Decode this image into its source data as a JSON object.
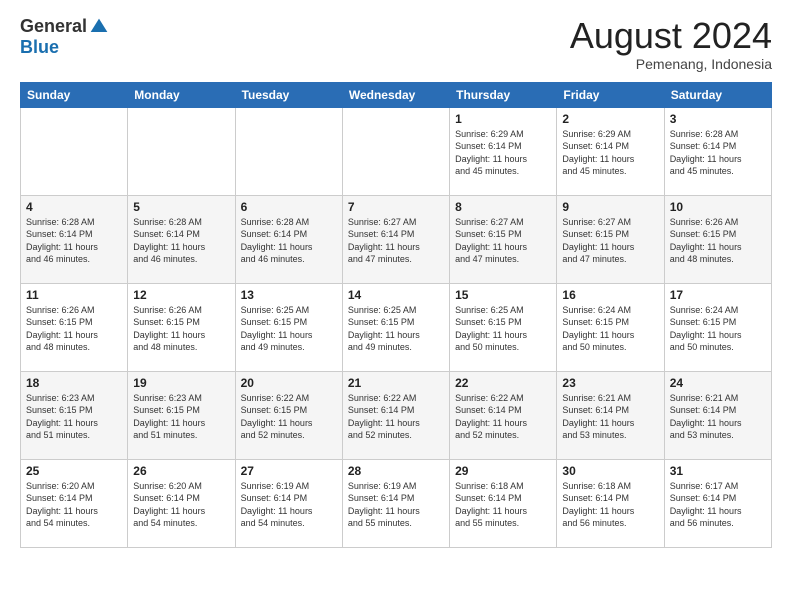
{
  "logo": {
    "general": "General",
    "blue": "Blue"
  },
  "title": {
    "month_year": "August 2024",
    "location": "Pemenang, Indonesia"
  },
  "headers": [
    "Sunday",
    "Monday",
    "Tuesday",
    "Wednesday",
    "Thursday",
    "Friday",
    "Saturday"
  ],
  "weeks": [
    [
      {
        "day": "",
        "info": ""
      },
      {
        "day": "",
        "info": ""
      },
      {
        "day": "",
        "info": ""
      },
      {
        "day": "",
        "info": ""
      },
      {
        "day": "1",
        "info": "Sunrise: 6:29 AM\nSunset: 6:14 PM\nDaylight: 11 hours\nand 45 minutes."
      },
      {
        "day": "2",
        "info": "Sunrise: 6:29 AM\nSunset: 6:14 PM\nDaylight: 11 hours\nand 45 minutes."
      },
      {
        "day": "3",
        "info": "Sunrise: 6:28 AM\nSunset: 6:14 PM\nDaylight: 11 hours\nand 45 minutes."
      }
    ],
    [
      {
        "day": "4",
        "info": "Sunrise: 6:28 AM\nSunset: 6:14 PM\nDaylight: 11 hours\nand 46 minutes."
      },
      {
        "day": "5",
        "info": "Sunrise: 6:28 AM\nSunset: 6:14 PM\nDaylight: 11 hours\nand 46 minutes."
      },
      {
        "day": "6",
        "info": "Sunrise: 6:28 AM\nSunset: 6:14 PM\nDaylight: 11 hours\nand 46 minutes."
      },
      {
        "day": "7",
        "info": "Sunrise: 6:27 AM\nSunset: 6:14 PM\nDaylight: 11 hours\nand 47 minutes."
      },
      {
        "day": "8",
        "info": "Sunrise: 6:27 AM\nSunset: 6:15 PM\nDaylight: 11 hours\nand 47 minutes."
      },
      {
        "day": "9",
        "info": "Sunrise: 6:27 AM\nSunset: 6:15 PM\nDaylight: 11 hours\nand 47 minutes."
      },
      {
        "day": "10",
        "info": "Sunrise: 6:26 AM\nSunset: 6:15 PM\nDaylight: 11 hours\nand 48 minutes."
      }
    ],
    [
      {
        "day": "11",
        "info": "Sunrise: 6:26 AM\nSunset: 6:15 PM\nDaylight: 11 hours\nand 48 minutes."
      },
      {
        "day": "12",
        "info": "Sunrise: 6:26 AM\nSunset: 6:15 PM\nDaylight: 11 hours\nand 48 minutes."
      },
      {
        "day": "13",
        "info": "Sunrise: 6:25 AM\nSunset: 6:15 PM\nDaylight: 11 hours\nand 49 minutes."
      },
      {
        "day": "14",
        "info": "Sunrise: 6:25 AM\nSunset: 6:15 PM\nDaylight: 11 hours\nand 49 minutes."
      },
      {
        "day": "15",
        "info": "Sunrise: 6:25 AM\nSunset: 6:15 PM\nDaylight: 11 hours\nand 50 minutes."
      },
      {
        "day": "16",
        "info": "Sunrise: 6:24 AM\nSunset: 6:15 PM\nDaylight: 11 hours\nand 50 minutes."
      },
      {
        "day": "17",
        "info": "Sunrise: 6:24 AM\nSunset: 6:15 PM\nDaylight: 11 hours\nand 50 minutes."
      }
    ],
    [
      {
        "day": "18",
        "info": "Sunrise: 6:23 AM\nSunset: 6:15 PM\nDaylight: 11 hours\nand 51 minutes."
      },
      {
        "day": "19",
        "info": "Sunrise: 6:23 AM\nSunset: 6:15 PM\nDaylight: 11 hours\nand 51 minutes."
      },
      {
        "day": "20",
        "info": "Sunrise: 6:22 AM\nSunset: 6:15 PM\nDaylight: 11 hours\nand 52 minutes."
      },
      {
        "day": "21",
        "info": "Sunrise: 6:22 AM\nSunset: 6:14 PM\nDaylight: 11 hours\nand 52 minutes."
      },
      {
        "day": "22",
        "info": "Sunrise: 6:22 AM\nSunset: 6:14 PM\nDaylight: 11 hours\nand 52 minutes."
      },
      {
        "day": "23",
        "info": "Sunrise: 6:21 AM\nSunset: 6:14 PM\nDaylight: 11 hours\nand 53 minutes."
      },
      {
        "day": "24",
        "info": "Sunrise: 6:21 AM\nSunset: 6:14 PM\nDaylight: 11 hours\nand 53 minutes."
      }
    ],
    [
      {
        "day": "25",
        "info": "Sunrise: 6:20 AM\nSunset: 6:14 PM\nDaylight: 11 hours\nand 54 minutes."
      },
      {
        "day": "26",
        "info": "Sunrise: 6:20 AM\nSunset: 6:14 PM\nDaylight: 11 hours\nand 54 minutes."
      },
      {
        "day": "27",
        "info": "Sunrise: 6:19 AM\nSunset: 6:14 PM\nDaylight: 11 hours\nand 54 minutes."
      },
      {
        "day": "28",
        "info": "Sunrise: 6:19 AM\nSunset: 6:14 PM\nDaylight: 11 hours\nand 55 minutes."
      },
      {
        "day": "29",
        "info": "Sunrise: 6:18 AM\nSunset: 6:14 PM\nDaylight: 11 hours\nand 55 minutes."
      },
      {
        "day": "30",
        "info": "Sunrise: 6:18 AM\nSunset: 6:14 PM\nDaylight: 11 hours\nand 56 minutes."
      },
      {
        "day": "31",
        "info": "Sunrise: 6:17 AM\nSunset: 6:14 PM\nDaylight: 11 hours\nand 56 minutes."
      }
    ]
  ]
}
